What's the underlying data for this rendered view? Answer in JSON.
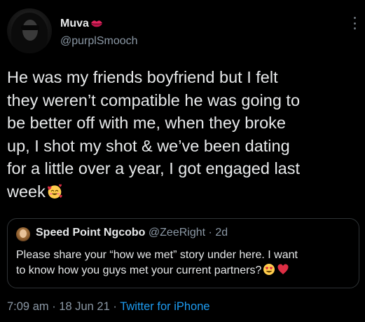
{
  "author": {
    "display_name": "Muva",
    "handle": "@purplSmooch",
    "name_emoji": "kiss-mark-icon",
    "avatar": "profile-avatar"
  },
  "tweet": {
    "lines": [
      "He was my friends boyfriend but I felt",
      "they weren’t compatible he was going to",
      "be better off with me, when they broke",
      "up, I shot my shot & we’ve been dating",
      "for a little over a year, I got engaged last",
      "week"
    ],
    "trailing_emoji": "smiling-face-with-hearts-icon"
  },
  "quoted_tweet": {
    "display_name": "Speed Point Ngcobo",
    "handle": "@ZeeRight",
    "separator": "·",
    "time": "2d",
    "lines": [
      "Please share your “how we met” story under here. I want",
      "to know how you guys met your current partners?"
    ],
    "emojis": [
      "heart-eyes-icon",
      "red-heart-icon"
    ]
  },
  "meta": {
    "time": "7:09 am",
    "separator": "·",
    "date": "18 Jun 21",
    "source": "Twitter for iPhone"
  },
  "colors": {
    "background": "#000000",
    "text": "#e7e9ea",
    "secondary_text": "#8b98a5",
    "link": "#1d9bf0",
    "border": "#2f3336"
  }
}
